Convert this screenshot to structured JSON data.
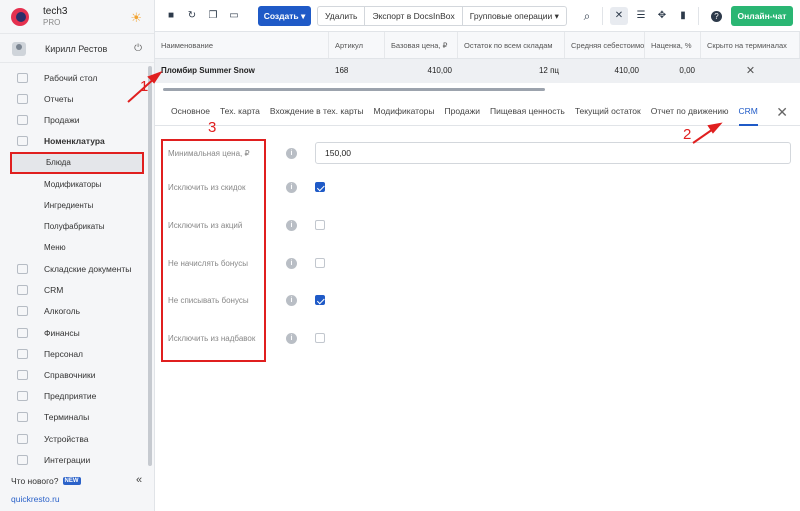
{
  "brand": {
    "name": "tech3",
    "plan": "PRO"
  },
  "user": {
    "name": "Кирилл Рестов"
  },
  "nav": {
    "items": [
      {
        "label": "Рабочий стол"
      },
      {
        "label": "Отчеты"
      },
      {
        "label": "Продажи"
      },
      {
        "label": "Номенклатура"
      },
      {
        "label": "Блюда"
      },
      {
        "label": "Модификаторы"
      },
      {
        "label": "Ингредиенты"
      },
      {
        "label": "Полуфабрикаты"
      },
      {
        "label": "Меню"
      },
      {
        "label": "Складские документы"
      },
      {
        "label": "CRM"
      },
      {
        "label": "Алкоголь"
      },
      {
        "label": "Финансы"
      },
      {
        "label": "Персонал"
      },
      {
        "label": "Справочники"
      },
      {
        "label": "Предприятие"
      },
      {
        "label": "Терминалы"
      },
      {
        "label": "Устройства"
      },
      {
        "label": "Интеграции"
      }
    ],
    "whats_new": "Что нового?",
    "new_badge": "NEW",
    "site": "quickresto.ru"
  },
  "toolbar": {
    "create_label": "Создать ▾",
    "delete_label": "Удалить",
    "export_label": "Экспорт в DocsInBox",
    "group_label": "Групповые операции ▾",
    "chat_label": "Онлайн-чат"
  },
  "table": {
    "headers": [
      "Наименование",
      "Артикул",
      "Базовая цена, ₽",
      "Остаток по всем складам",
      "Средняя себестоимость",
      "Наценка, %",
      "Скрыто на терминалах"
    ],
    "row": [
      "Пломбир Summer Snow",
      "168",
      "410,00",
      "12 пц",
      "410,00",
      "0,00",
      "✕"
    ]
  },
  "tabs": [
    "Основное",
    "Тех. карта",
    "Вхождение в тех. карты",
    "Модификаторы",
    "Продажи",
    "Пищевая ценность",
    "Текущий остаток",
    "Отчет по движению",
    "CRM"
  ],
  "form": {
    "min_price_label": "Минимальная цена, ₽",
    "min_price_value": "150,00",
    "fields": [
      {
        "label": "Исключить из скидок",
        "checked": true
      },
      {
        "label": "Исключить из акций",
        "checked": false
      },
      {
        "label": "Не начислять бонусы",
        "checked": false
      },
      {
        "label": "Не списывать бонусы",
        "checked": true
      },
      {
        "label": "Исключить из надбавок",
        "checked": false
      }
    ]
  },
  "annotations": {
    "a1": "1",
    "a2": "2",
    "a3": "3"
  },
  "colors": {
    "accent": "#1f5ac7",
    "success": "#2ab673",
    "annotation": "#e01f1f"
  }
}
